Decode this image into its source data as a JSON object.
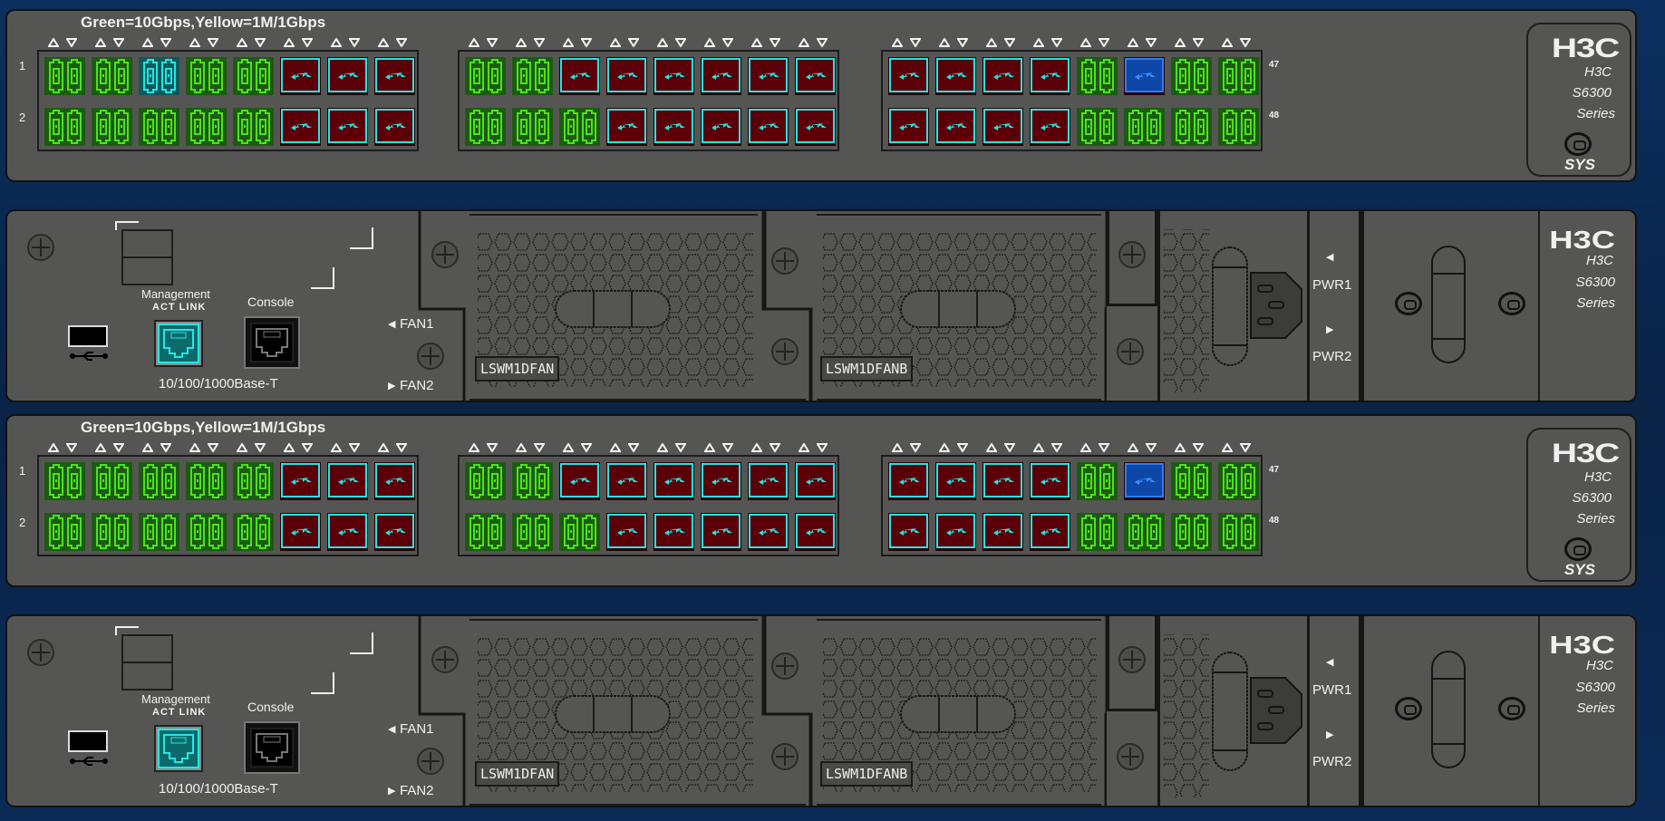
{
  "colors": {
    "green": "#4be31c",
    "teal": "#27e4e4",
    "red": "#5b0008",
    "blue": "#0e47a8",
    "panel": "#555653"
  },
  "units": [
    {
      "legend": "Green=10Gbps,Yellow=1M/1Gbps",
      "row_labels": [
        "1",
        "2"
      ],
      "end_labels": [
        "47",
        "48"
      ],
      "port_groups": [
        {
          "rows": [
            [
              "green",
              "green",
              "teal",
              "green",
              "green",
              "red",
              "red",
              "red"
            ],
            [
              "green",
              "green",
              "green",
              "green",
              "green",
              "red",
              "red",
              "red"
            ]
          ]
        },
        {
          "rows": [
            [
              "green",
              "green",
              "red",
              "red",
              "red",
              "red",
              "red",
              "red"
            ],
            [
              "green",
              "green",
              "green",
              "red",
              "red",
              "red",
              "red",
              "red"
            ]
          ]
        },
        {
          "rows": [
            [
              "red",
              "red",
              "red",
              "red",
              "green",
              "blue",
              "green",
              "green"
            ],
            [
              "red",
              "red",
              "red",
              "red",
              "green",
              "green",
              "green",
              "green"
            ]
          ]
        }
      ],
      "logo": {
        "brand": "H3C",
        "name": "H3C",
        "model": "S6300",
        "series": "Series",
        "sys": "SYS"
      },
      "management": {
        "label": "Management",
        "act_link": "ACT LINK",
        "speed": "10/100/1000Base-T"
      },
      "console": "Console",
      "fans": [
        "FAN1",
        "FAN2"
      ],
      "fan_modules": [
        "LSWM1DFAN",
        "LSWM1DFANB"
      ],
      "power": [
        "PWR1",
        "PWR2"
      ],
      "rear_logo": {
        "brand": "H3C",
        "name": "H3C",
        "model": "S6300",
        "series": "Series"
      }
    },
    {
      "legend": "Green=10Gbps,Yellow=1M/1Gbps",
      "row_labels": [
        "1",
        "2"
      ],
      "end_labels": [
        "47",
        "48"
      ],
      "port_groups": [
        {
          "rows": [
            [
              "green",
              "green",
              "green",
              "green",
              "green",
              "red",
              "red",
              "red"
            ],
            [
              "green",
              "green",
              "green",
              "green",
              "green",
              "red",
              "red",
              "red"
            ]
          ]
        },
        {
          "rows": [
            [
              "green",
              "green",
              "red",
              "red",
              "red",
              "red",
              "red",
              "red"
            ],
            [
              "green",
              "green",
              "green",
              "red",
              "red",
              "red",
              "red",
              "red"
            ]
          ]
        },
        {
          "rows": [
            [
              "red",
              "red",
              "red",
              "red",
              "green",
              "blue",
              "green",
              "green"
            ],
            [
              "red",
              "red",
              "red",
              "red",
              "green",
              "green",
              "green",
              "green"
            ]
          ]
        }
      ],
      "logo": {
        "brand": "H3C",
        "name": "H3C",
        "model": "S6300",
        "series": "Series",
        "sys": "SYS"
      },
      "management": {
        "label": "Management",
        "act_link": "ACT LINK",
        "speed": "10/100/1000Base-T"
      },
      "console": "Console",
      "fans": [
        "FAN1",
        "FAN2"
      ],
      "fan_modules": [
        "LSWM1DFAN",
        "LSWM1DFANB"
      ],
      "power": [
        "PWR1",
        "PWR2"
      ],
      "rear_logo": {
        "brand": "H3C",
        "name": "H3C",
        "model": "S6300",
        "series": "Series"
      }
    }
  ]
}
